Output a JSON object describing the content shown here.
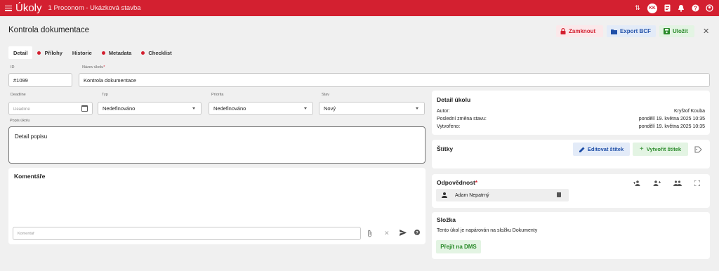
{
  "topbar": {
    "app_title": "Úkoly",
    "project": "1 Proconom - Ukázková stavba",
    "avatar_initials": "KK",
    "icons": [
      "sort-icon",
      "avatar",
      "document-icon",
      "bell-icon",
      "help-icon",
      "user-menu-icon"
    ]
  },
  "header": {
    "title": "Kontrola dokumentace",
    "lock_label": "Zamknout",
    "export_label": "Export BCF",
    "save_label": "Uložit"
  },
  "tabs": [
    {
      "label": "Detail",
      "active": true,
      "dot": false
    },
    {
      "label": "Přílohy",
      "active": false,
      "dot": true
    },
    {
      "label": "Historie",
      "active": false,
      "dot": false
    },
    {
      "label": "Metadata",
      "active": false,
      "dot": true
    },
    {
      "label": "Checklist",
      "active": false,
      "dot": true
    }
  ],
  "form": {
    "id_label": "ID",
    "id_value": "#1099",
    "name_label": "Název úkolu",
    "name_required": "*",
    "name_value": "Kontrola dokumentace",
    "deadline_label": "Deadline",
    "deadline_placeholder": "Deadline",
    "type_label": "Typ",
    "type_value": "Nedefinováno",
    "priority_label": "Priorita",
    "priority_value": "Nedefinováno",
    "state_label": "Stav",
    "state_value": "Nový",
    "desc_label": "Popis úkolu",
    "desc_value": "Detail popisu"
  },
  "comments": {
    "title": "Komentáře",
    "placeholder": "Komentář"
  },
  "detail_panel": {
    "title": "Detail úkolu",
    "rows": [
      {
        "key": "Autor:",
        "value": "Kryštof Kouba"
      },
      {
        "key": "Poslední změna stavu:",
        "value": "pondělí 19. května 2025 10:35"
      },
      {
        "key": "Vytvořeno:",
        "value": "pondělí 19. května 2025 10:35"
      }
    ]
  },
  "tags_panel": {
    "title": "Štítky",
    "edit_label": "Editovat štítek",
    "create_label": "Vytvořit štítek"
  },
  "responsibility_panel": {
    "title": "Odpovědnost",
    "required": "*",
    "person": "Adam Nepatrný"
  },
  "folder_panel": {
    "title": "Složka",
    "text": "Tento úkol je napárován na složku Dokumenty",
    "button_label": "Přejít na DMS"
  },
  "colors": {
    "brand": "#d32030",
    "blue_button": "#1f4fa8",
    "green_button": "#2a8a2a"
  }
}
